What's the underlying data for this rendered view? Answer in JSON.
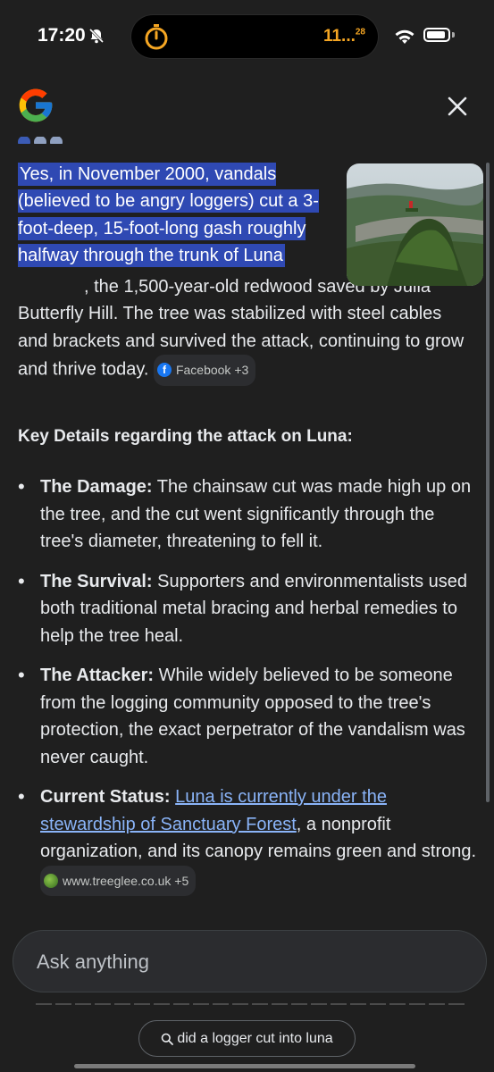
{
  "status_bar": {
    "time": "17:20",
    "timer_text": "11...",
    "timer_sup": "28",
    "accent_color": "#f5a623"
  },
  "header": {
    "logo_icon": "google-g-icon",
    "close_icon": "close-icon"
  },
  "answer": {
    "highlighted_text": "Yes, in November 2000, vandals (believed to be angry loggers) cut a 3-foot-deep, 15-foot-long gash roughly halfway through the trunk of Luna",
    "rest_text": ", the 1,500-year-old redwood saved by Julia Butterfly Hill. The tree was stabilized with steel cables and brackets and survived the attack, continuing to grow and thrive today.",
    "source_chip": "Facebook +3",
    "highlight_color": "#2f49b3"
  },
  "key_details": {
    "heading": "Key Details regarding the attack on Luna:",
    "items": [
      {
        "label": "The Damage:",
        "text": " The chainsaw cut was made high up on the tree, and the cut went significantly through the tree's diameter, threatening to fell it."
      },
      {
        "label": "The Survival:",
        "text": " Supporters and environmentalists used both traditional metal bracing and herbal remedies to help the tree heal."
      },
      {
        "label": "The Attacker:",
        "text": " While widely believed to be someone from the logging community opposed to the tree's protection, the exact perpetrator of the vandalism was never caught."
      },
      {
        "label": "Current Status:",
        "link": "Luna is currently under the stewardship of Sanctuary Forest",
        "text": ", a nonprofit organization, and its canopy remains green and strong.",
        "source_chip": "www.treeglee.co.uk +5"
      }
    ],
    "link_color": "#8ab4f8"
  },
  "ask_input": {
    "placeholder": "Ask anything"
  },
  "suggestion": {
    "label": "did a logger cut into luna",
    "icon": "search-icon"
  }
}
